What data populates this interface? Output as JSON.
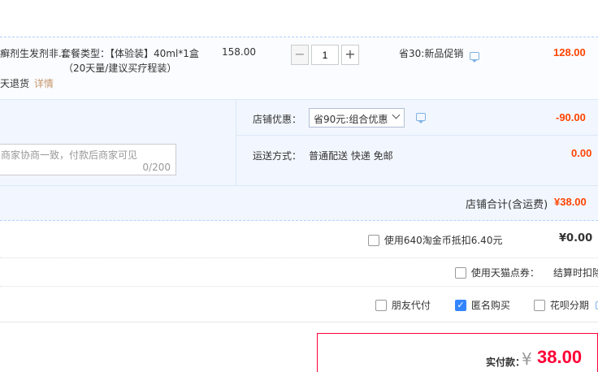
{
  "item": {
    "name": "癣剂生发剂非...",
    "package_label": "套餐类型：【体验装】40ml*1盒",
    "package_sub": "（20天量/建议买疗程装）",
    "return_policy": "天退货",
    "detail_link": "详情",
    "original_price": "158.00",
    "quantity": "1",
    "promo": "省30:新品促销",
    "subtotal": "128.00"
  },
  "store": {
    "discount_label": "店铺优惠：",
    "discount_select": "省90元:组合优惠",
    "discount_amount": "-90.00",
    "shipping_label": "运送方式：",
    "shipping_value": "普通配送 快递 免邮",
    "shipping_fee": "0.00",
    "message_placeholder": "商家协商一致，付款后商家可见",
    "message_count": "0/200",
    "total_label": "店铺合计(含运费)",
    "total_value": "¥38.00"
  },
  "options": {
    "taobao_coin": "使用640淘金币抵扣6.40元",
    "taobao_coin_value": "¥0.00",
    "tmall_points": "使用天猫点券：",
    "tmall_points_value": "结算时扣除",
    "friend_pay": "朋友代付",
    "anonymous": "匿名购买",
    "huabei": "花呗分期"
  },
  "payment": {
    "label": "实付款：",
    "currency": "¥",
    "amount": "38.00"
  },
  "colors": {
    "accent_red": "#ff0036",
    "light_blue_bg": "#f2f7ff",
    "border_blue": "#b2d1ff",
    "check_blue": "#3385ff"
  }
}
